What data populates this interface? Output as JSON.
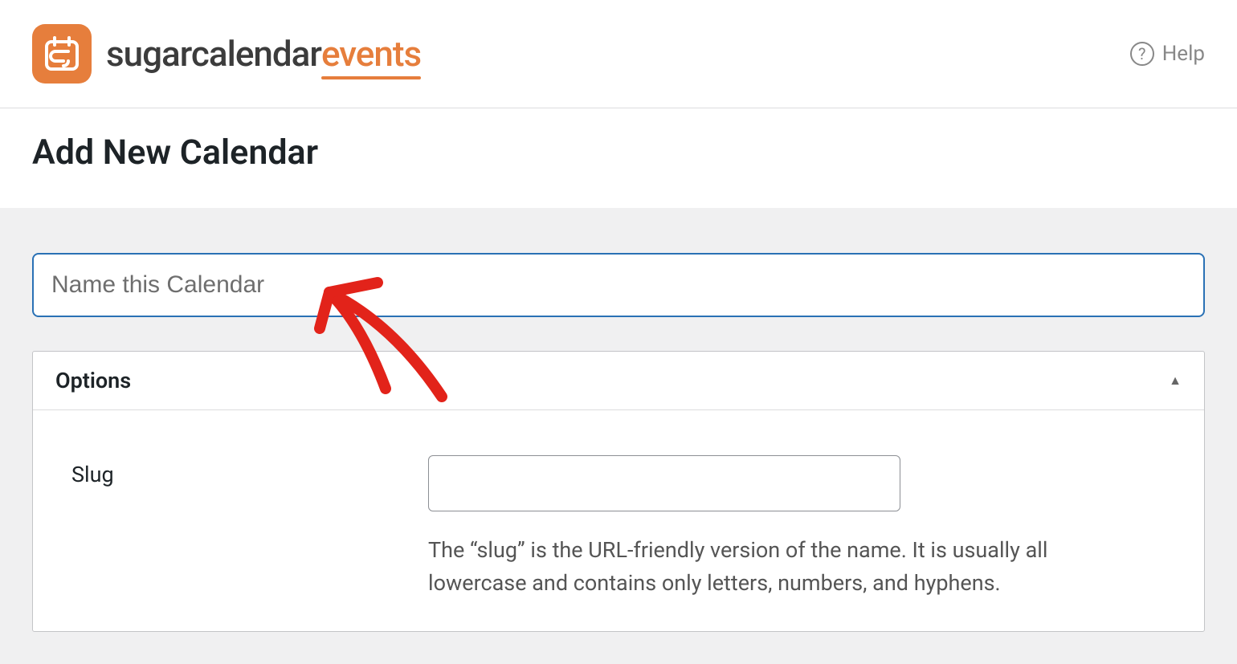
{
  "brand": {
    "first": "sugarcalendar",
    "second": "events"
  },
  "header": {
    "help_label": "Help"
  },
  "page": {
    "title": "Add New Calendar"
  },
  "form": {
    "name_placeholder": "Name this Calendar",
    "name_value": ""
  },
  "options": {
    "panel_title": "Options",
    "slug_label": "Slug",
    "slug_value": "",
    "slug_help": "The “slug” is the URL-friendly version of the name. It is usually all lowercase and contains only letters, numbers, and hyphens."
  }
}
